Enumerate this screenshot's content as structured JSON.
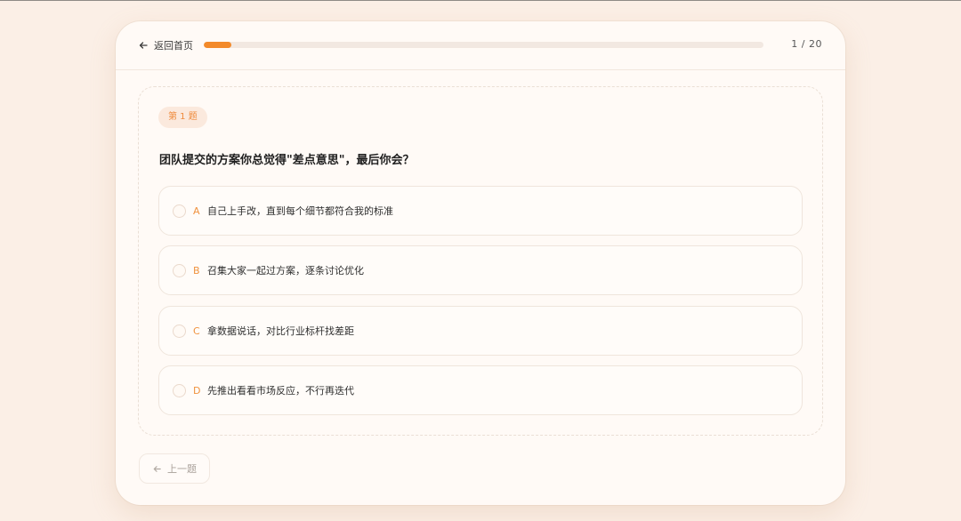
{
  "header": {
    "back_label": "返回首页",
    "progress_text": "1 / 20",
    "progress_fraction": 0.05
  },
  "question": {
    "badge": "第 1 题",
    "title": "团队提交的方案你总觉得\"差点意思\"，最后你会？",
    "options": [
      {
        "letter": "A",
        "text": "自己上手改，直到每个细节都符合我的标准"
      },
      {
        "letter": "B",
        "text": "召集大家一起过方案，逐条讨论优化"
      },
      {
        "letter": "C",
        "text": "拿数据说话，对比行业标杆找差距"
      },
      {
        "letter": "D",
        "text": "先推出看看市场反应，不行再迭代"
      }
    ]
  },
  "footer": {
    "prev_label": "上一题"
  },
  "colors": {
    "accent": "#f38a2b",
    "background": "#fbefe6",
    "card": "#fffaf6"
  },
  "icons": {
    "back": "arrow-left-icon",
    "prev": "arrow-left-icon"
  }
}
